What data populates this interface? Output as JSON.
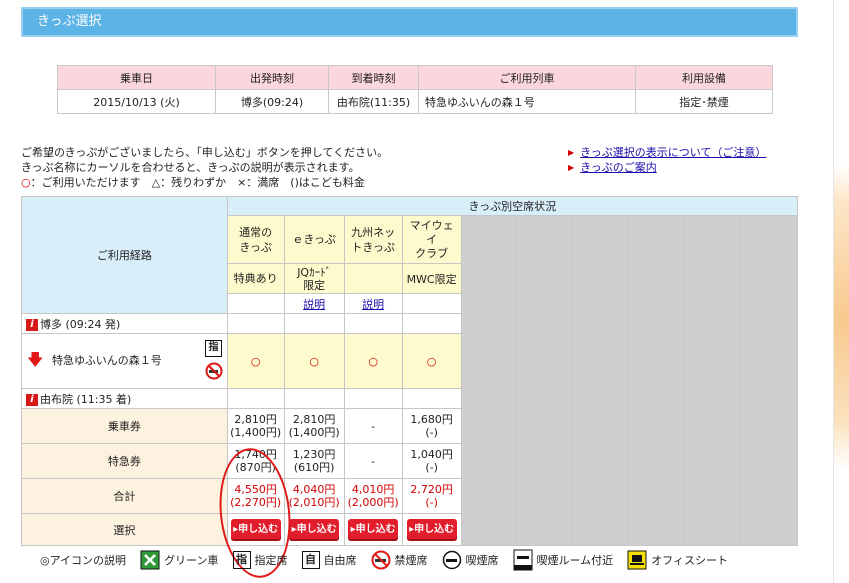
{
  "page": {
    "title": "きっぷ選択"
  },
  "trip_info": {
    "headers": [
      "乗車日",
      "出発時刻",
      "到着時刻",
      "ご利用列車",
      "利用設備"
    ],
    "values": [
      "2015/10/13 (火)",
      "博多(09:24)",
      "由布院(11:35)",
      "特急ゆふいんの森１号",
      "指定･禁煙"
    ]
  },
  "notes": {
    "line1": "ご希望のきっぷがございましたら、「申し込む」ボタンを押してください。",
    "line2": "きっぷ名称にカーソルを合わせると、きっぷの説明が表示されます。",
    "line3_mark": "○",
    "line3_rest": "：ご利用いただけます　△：残りわずか　×：満席　()はこども料金"
  },
  "links": {
    "display_note": "きっぷ選択の表示について（ご注意）",
    "guide": "きっぷのご案内"
  },
  "table": {
    "route_header": "ご利用経路",
    "availability_header": "きっぷ別空席状況",
    "ticket_names": [
      "通常の\nきっぷ",
      "ｅきっぷ",
      "九州ネッ\nトきっぷ",
      "マイウェ\nイ\nクラブ"
    ],
    "ticket_sub": [
      "特典あり",
      "JQｶｰﾄﾞ\n限定",
      "",
      "MWC限定"
    ],
    "desc_links": [
      "",
      "説明",
      "説明",
      ""
    ],
    "departure": "博多 (09:24 発)",
    "train_name": "特急ゆふいんの森１号",
    "reserved_glyph": "指",
    "availability": [
      "○",
      "○",
      "○",
      "○"
    ],
    "arrival": "由布院 (11:35 着)",
    "rows": [
      {
        "label": "乗車券",
        "cells": [
          [
            "2,810円",
            "(1,400円)"
          ],
          [
            "2,810円",
            "(1,400円)"
          ],
          [
            "-",
            ""
          ],
          [
            "1,680円",
            "(-)"
          ]
        ]
      },
      {
        "label": "特急券",
        "cells": [
          [
            "1,740円",
            "(870円)"
          ],
          [
            "1,230円",
            "(610円)"
          ],
          [
            "-",
            ""
          ],
          [
            "1,040円",
            "(-)"
          ]
        ]
      },
      {
        "label": "合計",
        "cells": [
          [
            "4,550円",
            "(2,270円)"
          ],
          [
            "4,040円",
            "(2,010円)"
          ],
          [
            "4,010円",
            "(2,000円)"
          ],
          [
            "2,720円",
            "(-)"
          ]
        ]
      }
    ],
    "select_label": "選択",
    "apply_label": "▸申し込む"
  },
  "legend": {
    "title": "◎アイコンの説明",
    "items": [
      {
        "glyph": "",
        "label": "グリーン車"
      },
      {
        "glyph": "指",
        "label": "指定席"
      },
      {
        "glyph": "自",
        "label": "自由席"
      },
      {
        "glyph": "",
        "label": "禁煙席"
      },
      {
        "glyph": "",
        "label": "喫煙席"
      },
      {
        "glyph": "",
        "label": "喫煙ルーム付近"
      },
      {
        "glyph": "",
        "label": "オフィスシート"
      }
    ]
  },
  "colors": {
    "title_bar": "#5cb3e6",
    "header_pink": "#fbd6dd",
    "blue_header": "#d8eef9",
    "yellow": "#fdfacd",
    "peach": "#fdf1df",
    "apply_red": "#e21d2c"
  }
}
